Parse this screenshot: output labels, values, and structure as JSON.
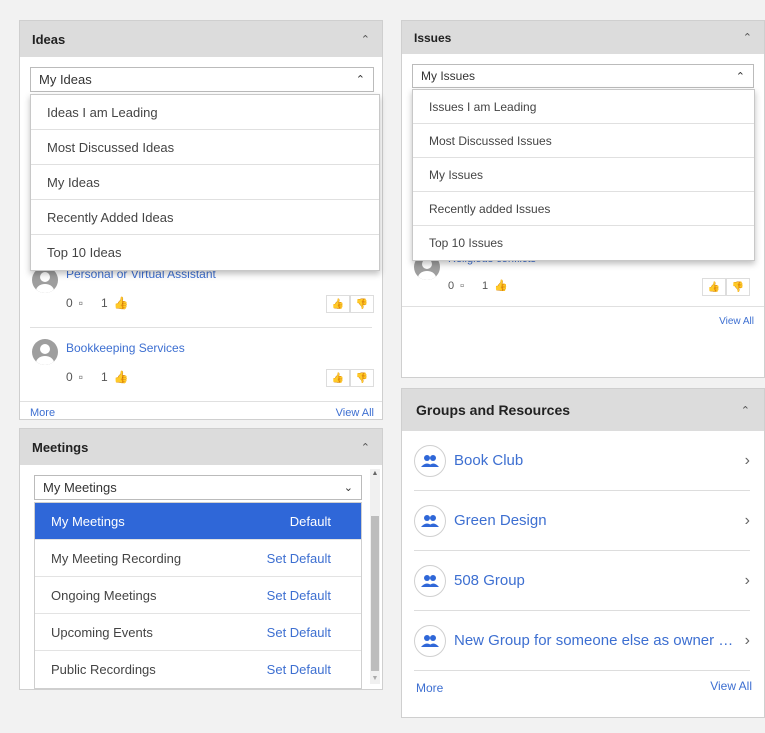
{
  "ideas": {
    "title": "Ideas",
    "select_value": "My Ideas",
    "options": [
      "Ideas I am Leading",
      "Most Discussed Ideas",
      "My Ideas",
      "Recently Added Ideas",
      "Top 10 Ideas"
    ],
    "items": [
      {
        "title": "Personal or Virtual Assistant",
        "comments": "0",
        "likes": "1"
      },
      {
        "title": "Bookkeeping Services",
        "comments": "0",
        "likes": "1"
      }
    ],
    "more": "More",
    "view_all": "View All"
  },
  "issues": {
    "title": "Issues",
    "select_value": "My Issues",
    "options": [
      "Issues I am Leading",
      "Most Discussed Issues",
      "My Issues",
      "Recently added Issues",
      "Top 10 Issues"
    ],
    "items": [
      {
        "title": "Religious conflicts",
        "comments": "0",
        "likes": "1"
      }
    ],
    "view_all": "View All"
  },
  "meetings": {
    "title": "Meetings",
    "select_value": "My Meetings",
    "rows": [
      {
        "label": "My Meetings",
        "action": "Default"
      },
      {
        "label": "My Meeting Recording",
        "action": "Set Default"
      },
      {
        "label": "Ongoing Meetings",
        "action": "Set Default"
      },
      {
        "label": "Upcoming Events",
        "action": "Set Default"
      },
      {
        "label": "Public Recordings",
        "action": "Set Default"
      }
    ]
  },
  "groups": {
    "title": "Groups and Resources",
    "items": [
      {
        "name": "Book Club"
      },
      {
        "name": "Green Design"
      },
      {
        "name": "508 Group"
      },
      {
        "name": "New Group for someone else as owner - no..."
      }
    ],
    "more": "More",
    "view_all": "View All"
  },
  "colors": {
    "accent": "#2f67d8",
    "link": "#3d6fd1",
    "header": "#dcdcdc"
  }
}
